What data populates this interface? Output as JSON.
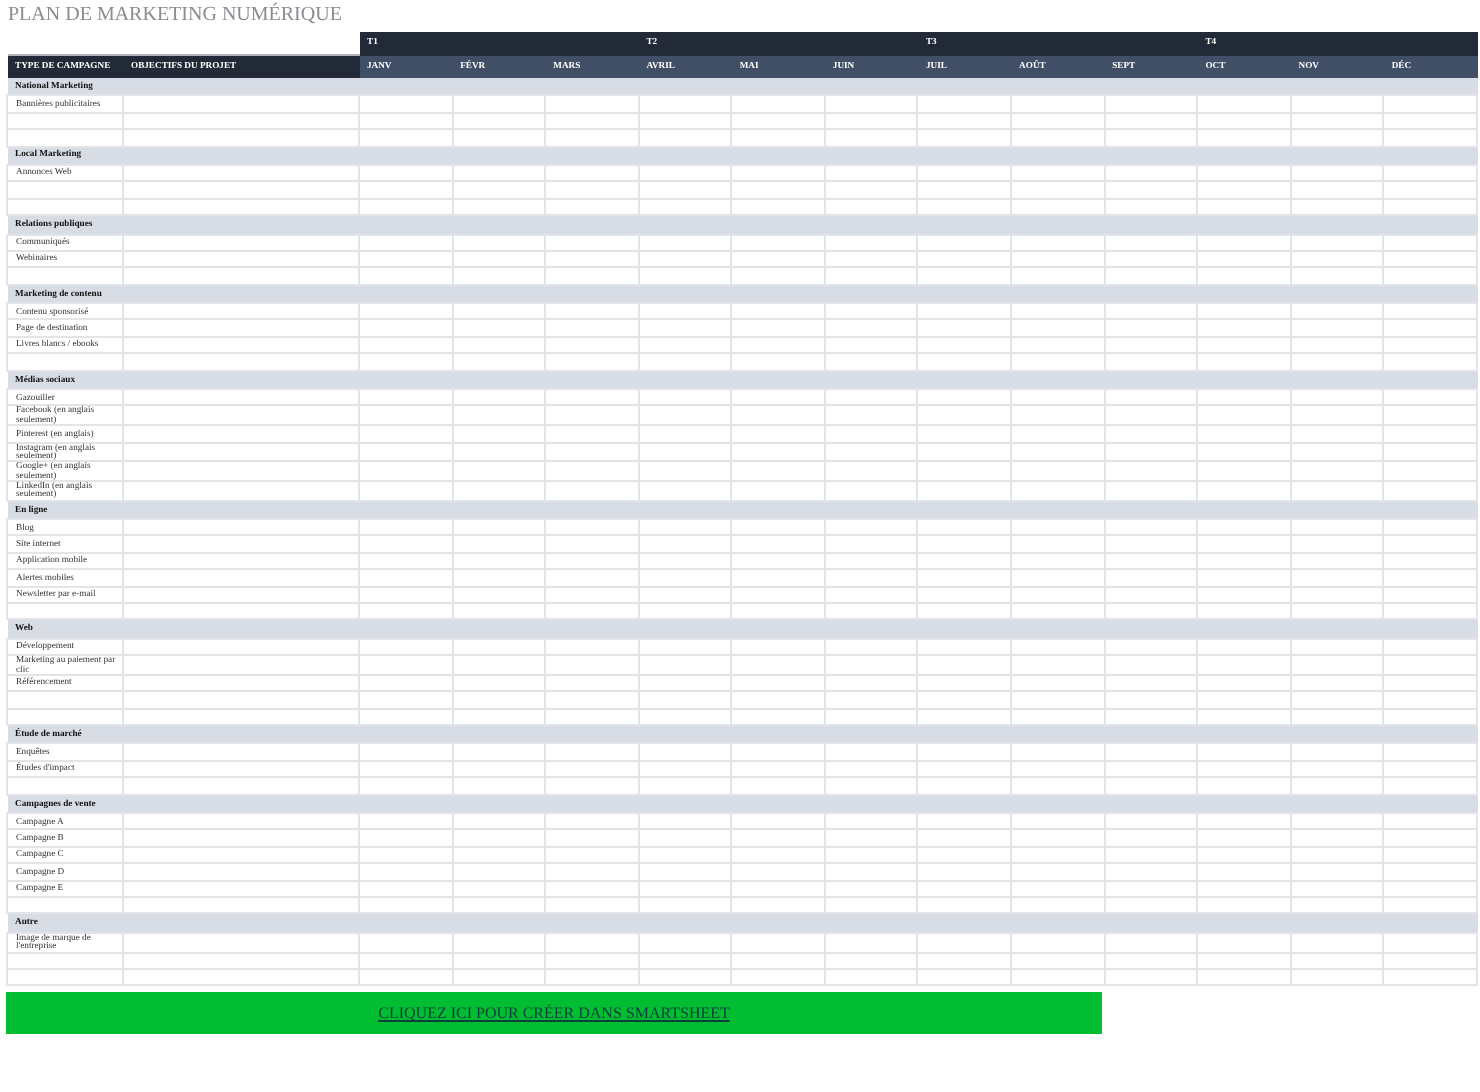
{
  "title": "PLAN DE MARKETING NUMÉRIQUE",
  "quarters": [
    "T1",
    "T2",
    "T3",
    "T4"
  ],
  "columns": [
    "TYPE DE CAMPAGNE",
    "OBJECTIFS DU PROJET"
  ],
  "months": [
    "JANV",
    "FÉVR",
    "MARS",
    "AVRIL",
    "MAI",
    "JUIN",
    "JUIL",
    "AOÛT",
    "SEPT",
    "OCT",
    "NOV",
    "DÉC"
  ],
  "sections": [
    {
      "name": "National Marketing",
      "rows": [
        {
          "campaign": "Bannières publicitaires"
        },
        {},
        {}
      ]
    },
    {
      "name": "Local Marketing",
      "rows": [
        {
          "campaign": "Annonces Web"
        },
        {},
        {}
      ]
    },
    {
      "name": "Relations publiques",
      "rows": [
        {
          "campaign": "Communiqués"
        },
        {
          "campaign": "Webinaires"
        },
        {}
      ]
    },
    {
      "name": "Marketing de contenu",
      "rows": [
        {
          "campaign": "Contenu sponsorisé"
        },
        {
          "campaign": "Page de destination"
        },
        {
          "campaign": "Livres blancs / ebooks"
        },
        {}
      ]
    },
    {
      "name": "Médias sociaux",
      "rows": [
        {
          "campaign": "Gazouiller"
        },
        {
          "campaign": "Facebook (en anglais seulement)"
        },
        {
          "campaign": "Pinterest (en anglais)"
        },
        {
          "campaign": "Instagram (en anglais seulement)"
        },
        {
          "campaign": "Google+ (en anglais seulement)"
        },
        {
          "campaign": "LinkedIn (en anglais seulement)"
        }
      ]
    },
    {
      "name": "En ligne",
      "rows": [
        {
          "campaign": "Blog"
        },
        {
          "campaign": "Site internet"
        },
        {
          "campaign": "Application mobile"
        },
        {
          "campaign": "Alertes mobiles"
        },
        {
          "campaign": "Newsletter par e-mail"
        },
        {}
      ]
    },
    {
      "name": "Web",
      "rows": [
        {
          "campaign": "Développement"
        },
        {
          "campaign": "Marketing au paiement par clic"
        },
        {
          "campaign": "Référencement"
        },
        {},
        {}
      ]
    },
    {
      "name": "Étude de marché",
      "rows": [
        {
          "campaign": "Enquêtes"
        },
        {
          "campaign": "Études d'impact"
        },
        {}
      ]
    },
    {
      "name": "Campagnes de vente",
      "rows": [
        {
          "campaign": "Campagne A"
        },
        {
          "campaign": "Campagne B"
        },
        {
          "campaign": "Campagne C"
        },
        {
          "campaign": "Campagne D"
        },
        {
          "campaign": "Campagne E"
        },
        {}
      ]
    },
    {
      "name": "Autre",
      "rows": [
        {
          "campaign": "Image de marque de l'entreprise"
        },
        {},
        {}
      ]
    }
  ],
  "cta": "CLIQUEZ ICI POUR CRÉER DANS SMARTSHEET"
}
